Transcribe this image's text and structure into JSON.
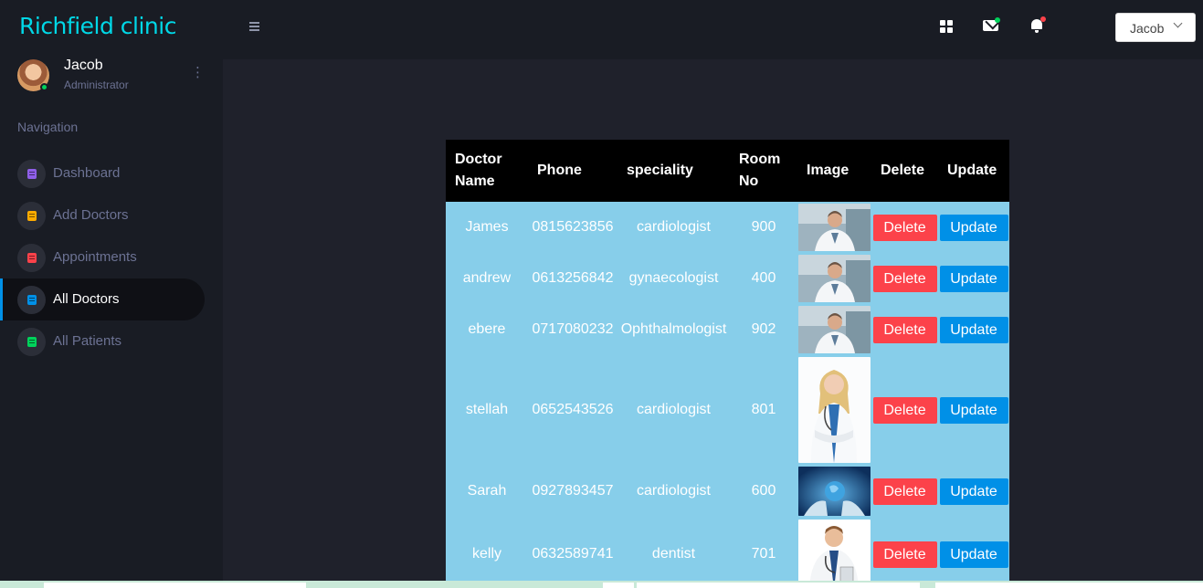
{
  "brand": "Richfield clinic",
  "profile": {
    "name": "Jacob",
    "role": "Administrator"
  },
  "nav_title": "Navigation",
  "nav": [
    {
      "label": "Dashboard",
      "color": "#8f5fe8"
    },
    {
      "label": "Add Doctors",
      "color": "#ffab00"
    },
    {
      "label": "Appointments",
      "color": "#fc424a"
    },
    {
      "label": "All Doctors",
      "color": "#0090e7",
      "active": true
    },
    {
      "label": "All Patients",
      "color": "#00d25b"
    }
  ],
  "topbar": {
    "user_dropdown": "Jacob"
  },
  "table": {
    "headers": [
      "Doctor Name",
      "Phone",
      "speciality",
      "Room No",
      "Image",
      "Delete",
      "Update"
    ],
    "rows": [
      {
        "name": "James",
        "phone": "0815623856",
        "speciality": "cardiologist",
        "room": "900",
        "image": "male-doctor-photo",
        "delete": "Delete",
        "update": "Update"
      },
      {
        "name": "andrew",
        "phone": "0613256842",
        "speciality": "gynaecologist",
        "room": "400",
        "image": "male-doctor-photo",
        "delete": "Delete",
        "update": "Update"
      },
      {
        "name": "ebere",
        "phone": "0717080232",
        "speciality": "Ophthalmologist",
        "room": "902",
        "image": "male-doctor-photo",
        "delete": "Delete",
        "update": "Update"
      },
      {
        "name": "stellah",
        "phone": "0652543526",
        "speciality": "cardiologist",
        "room": "801",
        "image": "female-doctor-photo",
        "delete": "Delete",
        "update": "Update"
      },
      {
        "name": "Sarah",
        "phone": "0927893457",
        "speciality": "cardiologist",
        "room": "600",
        "image": "globe-hands-photo",
        "delete": "Delete",
        "update": "Update"
      },
      {
        "name": "kelly",
        "phone": "0632589741",
        "speciality": "dentist",
        "room": "701",
        "image": "young-doctor-photo",
        "delete": "Delete",
        "update": "Update"
      }
    ]
  },
  "colors": {
    "brand": "#00d8e7",
    "sidebar_bg": "#191c24",
    "page_bg": "#1f212b",
    "table_header_bg": "#000000",
    "table_row_bg": "#87ceea",
    "delete_btn": "#fc424a",
    "update_btn": "#0090e7"
  }
}
